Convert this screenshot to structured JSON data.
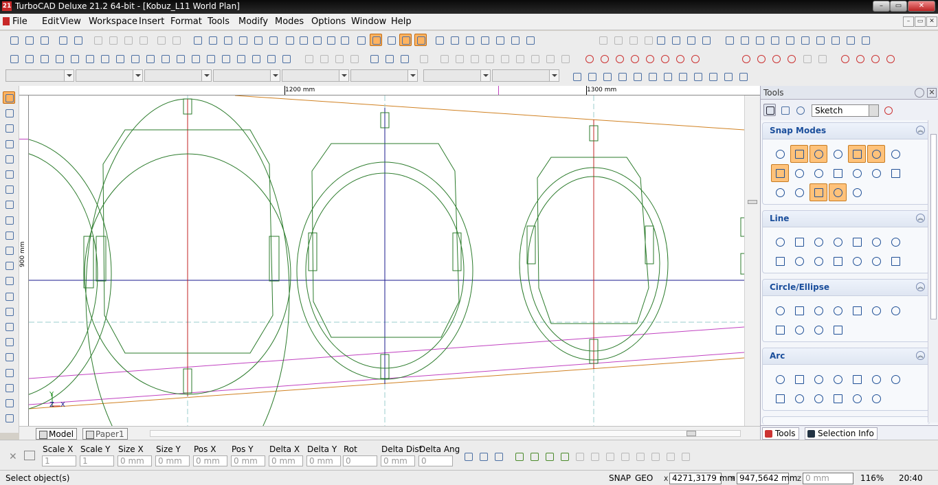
{
  "window": {
    "title": "TurboCAD Deluxe 21.2 64-bit - [Kobuz_L11 World Plan]",
    "icon_label": "21",
    "minimize": "–",
    "maximize": "▭",
    "close": "✕"
  },
  "menu": [
    "File",
    "Edit",
    "View",
    "Workspace",
    "Insert",
    "Format",
    "Tools",
    "Modify",
    "Modes",
    "Options",
    "Window",
    "Help"
  ],
  "mdi": {
    "minimize": "–",
    "restore": "▭",
    "close": "✕"
  },
  "rulers": {
    "top": [
      "1200 mm",
      "1300 mm"
    ],
    "left": "900 mm"
  },
  "canvas": {
    "axis_y": "Y",
    "axis_z": "Z",
    "axis_x": "X"
  },
  "tabs": {
    "model": "Model",
    "paper": "Paper1"
  },
  "tools_panel": {
    "title": "Tools",
    "mode": "Sketch",
    "sections": [
      {
        "title": "Snap Modes"
      },
      {
        "title": "Line"
      },
      {
        "title": "Circle/Ellipse"
      },
      {
        "title": "Arc"
      }
    ],
    "bottom_tabs": {
      "tools": "Tools",
      "selection": "Selection Info"
    }
  },
  "inspector": {
    "fields": [
      {
        "label": "Scale X",
        "value": "1"
      },
      {
        "label": "Scale Y",
        "value": "1"
      },
      {
        "label": "Size X",
        "value": "0 mm"
      },
      {
        "label": "Size Y",
        "value": "0 mm"
      },
      {
        "label": "Pos X",
        "value": "0 mm"
      },
      {
        "label": "Pos Y",
        "value": "0 mm"
      },
      {
        "label": "Delta X",
        "value": "0 mm"
      },
      {
        "label": "Delta Y",
        "value": "0 mm"
      },
      {
        "label": "Rot",
        "value": "0"
      },
      {
        "label": "Delta Dist",
        "value": "0 mm"
      },
      {
        "label": "Delta Ang",
        "value": "0"
      }
    ]
  },
  "status": {
    "prompt": "Select object(s)",
    "snap": "SNAP",
    "geo": "GEO",
    "x_label": "X",
    "x": "4271,3179 mm",
    "y_label": "Y",
    "y": "947,5642 mm",
    "z_label": "Z",
    "z": "0 mm",
    "zoom": "116%",
    "time": "20:40"
  }
}
